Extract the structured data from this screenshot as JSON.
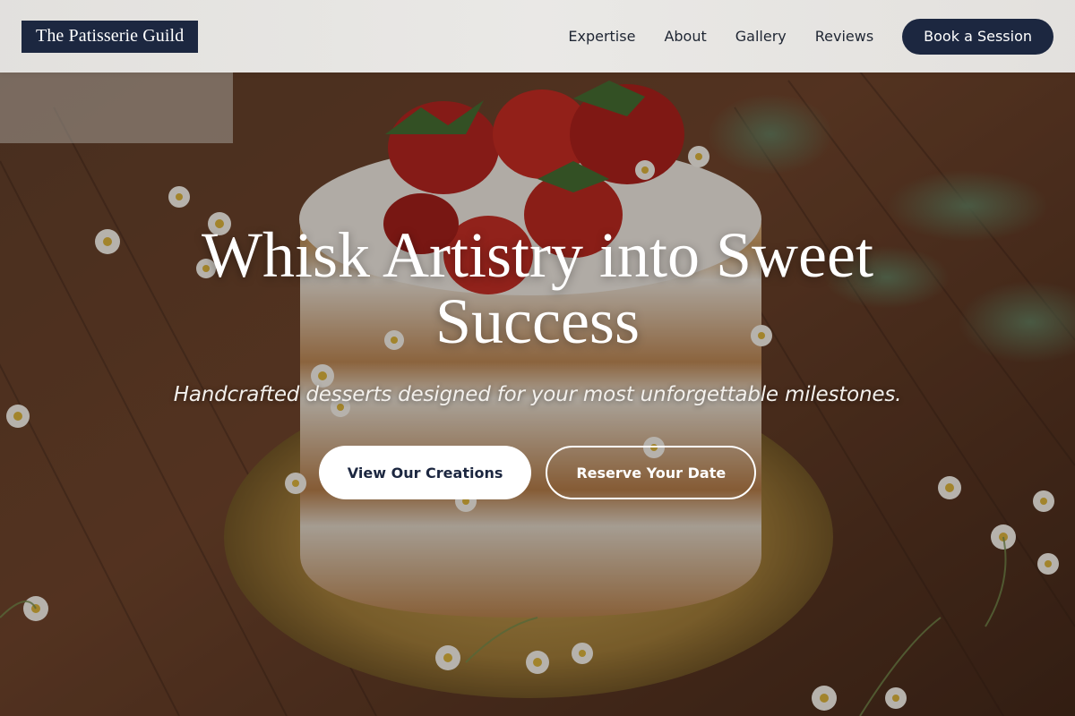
{
  "header": {
    "logo_text": "The Patisserie Guild",
    "nav": [
      {
        "label": "Expertise"
      },
      {
        "label": "About"
      },
      {
        "label": "Gallery"
      },
      {
        "label": "Reviews"
      }
    ],
    "cta_label": "Book a Session"
  },
  "hero": {
    "title": "Whisk Artistry into Sweet Success",
    "subtitle": "Handcrafted desserts designed for your most unforgettable milestones.",
    "primary_button": "View Our Creations",
    "secondary_button": "Reserve Your Date",
    "background_image": "naked-layer-cake-with-strawberries-and-chamomile-flowers"
  },
  "colors": {
    "brand_navy": "#1c2740",
    "header_bg": "#efefed",
    "text_dark": "#1f2633",
    "white": "#ffffff"
  }
}
